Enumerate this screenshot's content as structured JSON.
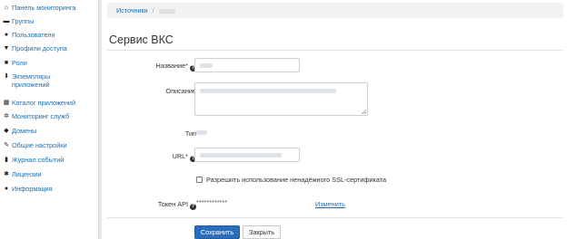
{
  "sidebar": {
    "items": [
      {
        "label": "Панель мониторинга",
        "icon": "home-icon",
        "glyph": "⌂"
      },
      {
        "label": "Группы",
        "icon": "folder-icon",
        "glyph": "▬"
      },
      {
        "label": "Пользователи",
        "icon": "user-icon",
        "glyph": "●"
      },
      {
        "label": "Профили доступа",
        "icon": "filter-icon",
        "glyph": "▼"
      },
      {
        "label": "Роли",
        "icon": "briefcase-icon",
        "glyph": "■"
      },
      {
        "label": "Экземпляры приложений",
        "icon": "person-download-icon",
        "glyph": "⬇"
      },
      {
        "label": "Каталог приложений",
        "icon": "grid-icon",
        "glyph": "▦"
      },
      {
        "label": "Мониторинг служб",
        "icon": "gear-icon",
        "glyph": "✲"
      },
      {
        "label": "Домены",
        "icon": "tag-icon",
        "glyph": "◆"
      },
      {
        "label": "Общие настройки",
        "icon": "wrench-icon",
        "glyph": "✎"
      },
      {
        "label": "Журнал событий",
        "icon": "book-icon",
        "glyph": "▮"
      },
      {
        "label": "Лицензии",
        "icon": "asterisk-icon",
        "glyph": "✱"
      },
      {
        "label": "Информация",
        "icon": "info-icon",
        "glyph": "●"
      }
    ]
  },
  "breadcrumb": {
    "root": "Источники",
    "separator": "/"
  },
  "page": {
    "title": "Сервис ВКС"
  },
  "form": {
    "name_label": "Название*",
    "description_label": "Описание",
    "type_label": "Тип",
    "url_label": "URL*",
    "ssl_checkbox_label": "Разрешить использование ненадёжного SSL-сертификата",
    "ssl_checked": false,
    "token_label": "Токен API",
    "token_value": "************",
    "token_change_link": "Изменить",
    "help_glyph": "?"
  },
  "buttons": {
    "save": "Сохранить",
    "close": "Закрыть"
  },
  "colors": {
    "accent": "#2a6ebb",
    "link": "#1a6fb8"
  }
}
